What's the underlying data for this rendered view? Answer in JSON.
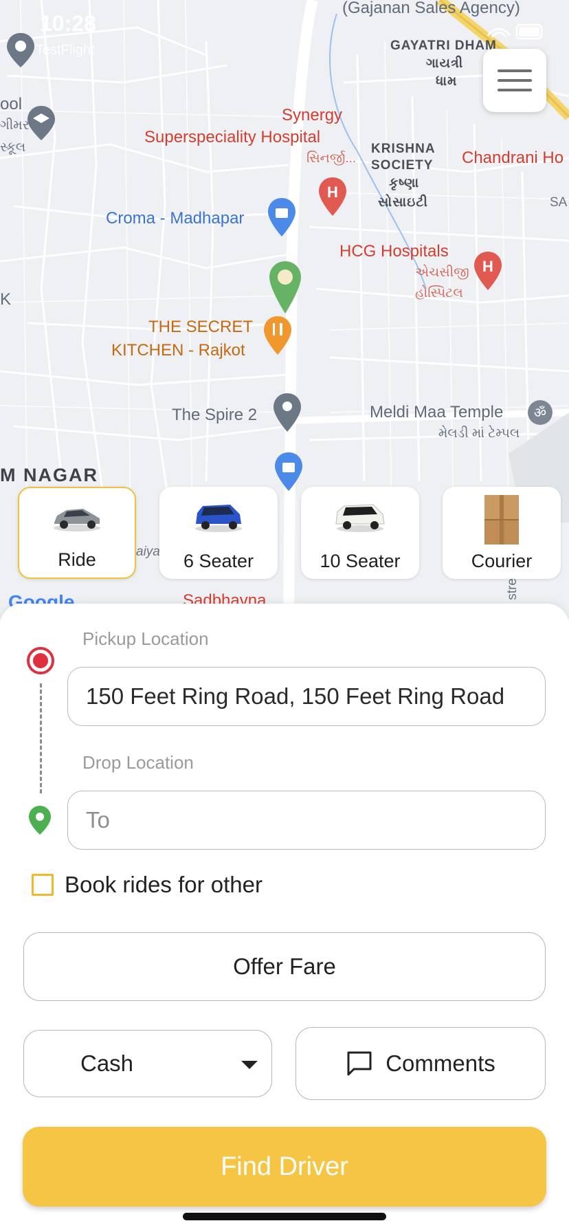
{
  "status_bar": {
    "time": "10:28",
    "back_app": "TestFlight"
  },
  "map": {
    "labels": {
      "gajanan": "(Gajanan Sales Agency)",
      "gayatri_en": "GAYATRI DHAM",
      "gayatri_gu1": "ગાયત્રી",
      "gayatri_gu2": "ધામ",
      "school_frag": "ool",
      "school_gu1": "ગીમર",
      "school_gu2": "સ્કૂલ",
      "synergy1": "Synergy",
      "synergy2": "Superspeciality Hospital",
      "synergy_gu": "સિનર્જી...",
      "krishna_en1": "KRISHNA",
      "krishna_en2": "SOCIETY",
      "krishna_gu1": "કૃષ્ણા",
      "krishna_gu2": "સોસાઇટી",
      "chandrani": "Chandrani Ho",
      "sa_frag": "SA",
      "croma": "Croma - Madhapar",
      "hcg": "HCG Hospitals",
      "hcg_gu1": "એચસીજી",
      "hcg_gu2": "હોસ્પિટલ",
      "k_frag": "K",
      "secret1": "THE SECRET",
      "secret2": "KITCHEN - Rajkot",
      "spire": "The Spire 2",
      "meldi": "Meldi Maa Temple",
      "meldi_gu": "મેલડી માં ટેમ્પલ",
      "area": "M NAGAR",
      "sadbhavna": "Sadbhavna",
      "google": "Google",
      "aiya_frag": "aiya",
      "stre_frag": "stre"
    }
  },
  "vehicles": [
    {
      "label": "Ride",
      "icon": "car-icon",
      "selected": true
    },
    {
      "label": "6 Seater",
      "icon": "van-icon",
      "selected": false
    },
    {
      "label": "10 Seater",
      "icon": "minibus-icon",
      "selected": false
    },
    {
      "label": "Courier",
      "icon": "parcel-box-icon",
      "selected": false
    }
  ],
  "form": {
    "pickup_title": "Pickup Location",
    "pickup_value": "150 Feet Ring Road, 150 Feet Ring Road",
    "drop_title": "Drop Location",
    "drop_placeholder": "To",
    "book_for_other": "Book rides for other",
    "offer_fare": "Offer Fare",
    "payment_method": "Cash",
    "comments": "Comments",
    "find_driver": "Find Driver"
  },
  "colors": {
    "accent": "#f6c544",
    "selected_border": "#f2c23a",
    "pickup_marker": "#e0303e",
    "drop_marker": "#4caf50"
  }
}
